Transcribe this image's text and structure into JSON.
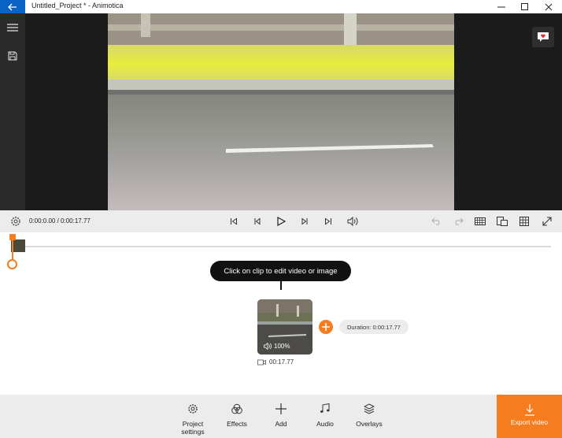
{
  "window": {
    "title": "Untitled_Project * - Animotica"
  },
  "transport": {
    "time": "0:00:0.00 / 0:00:17.77"
  },
  "timeline": {
    "tooltip": "Click on clip to edit video or image",
    "clip_volume": "100%",
    "clip_duration": "00:17.77",
    "duration_pill": "Duration: 0:00:17.77"
  },
  "toolbar": {
    "project_settings_line1": "Project",
    "project_settings_line2": "settings",
    "effects": "Effects",
    "add": "Add",
    "audio": "Audio",
    "overlays": "Overlays",
    "export": "Export video"
  },
  "colors": {
    "accent": "#f57c1f",
    "titlebar_back": "#0a64c6",
    "preview_bg": "#1b1b1b"
  },
  "icons": [
    "back-arrow-icon",
    "minimize-icon",
    "maximize-icon",
    "close-icon",
    "hamburger-icon",
    "save-icon",
    "feedback-icon",
    "settings-gear-icon",
    "skip-start-icon",
    "step-back-icon",
    "play-icon",
    "step-forward-icon",
    "skip-end-icon",
    "volume-icon",
    "undo-icon",
    "redo-icon",
    "storyboard-icon",
    "aspect-ratio-icon",
    "grid-icon",
    "fullscreen-icon",
    "add-plus-icon",
    "video-camera-icon",
    "effects-icon",
    "music-note-icon",
    "layers-icon",
    "download-icon"
  ]
}
